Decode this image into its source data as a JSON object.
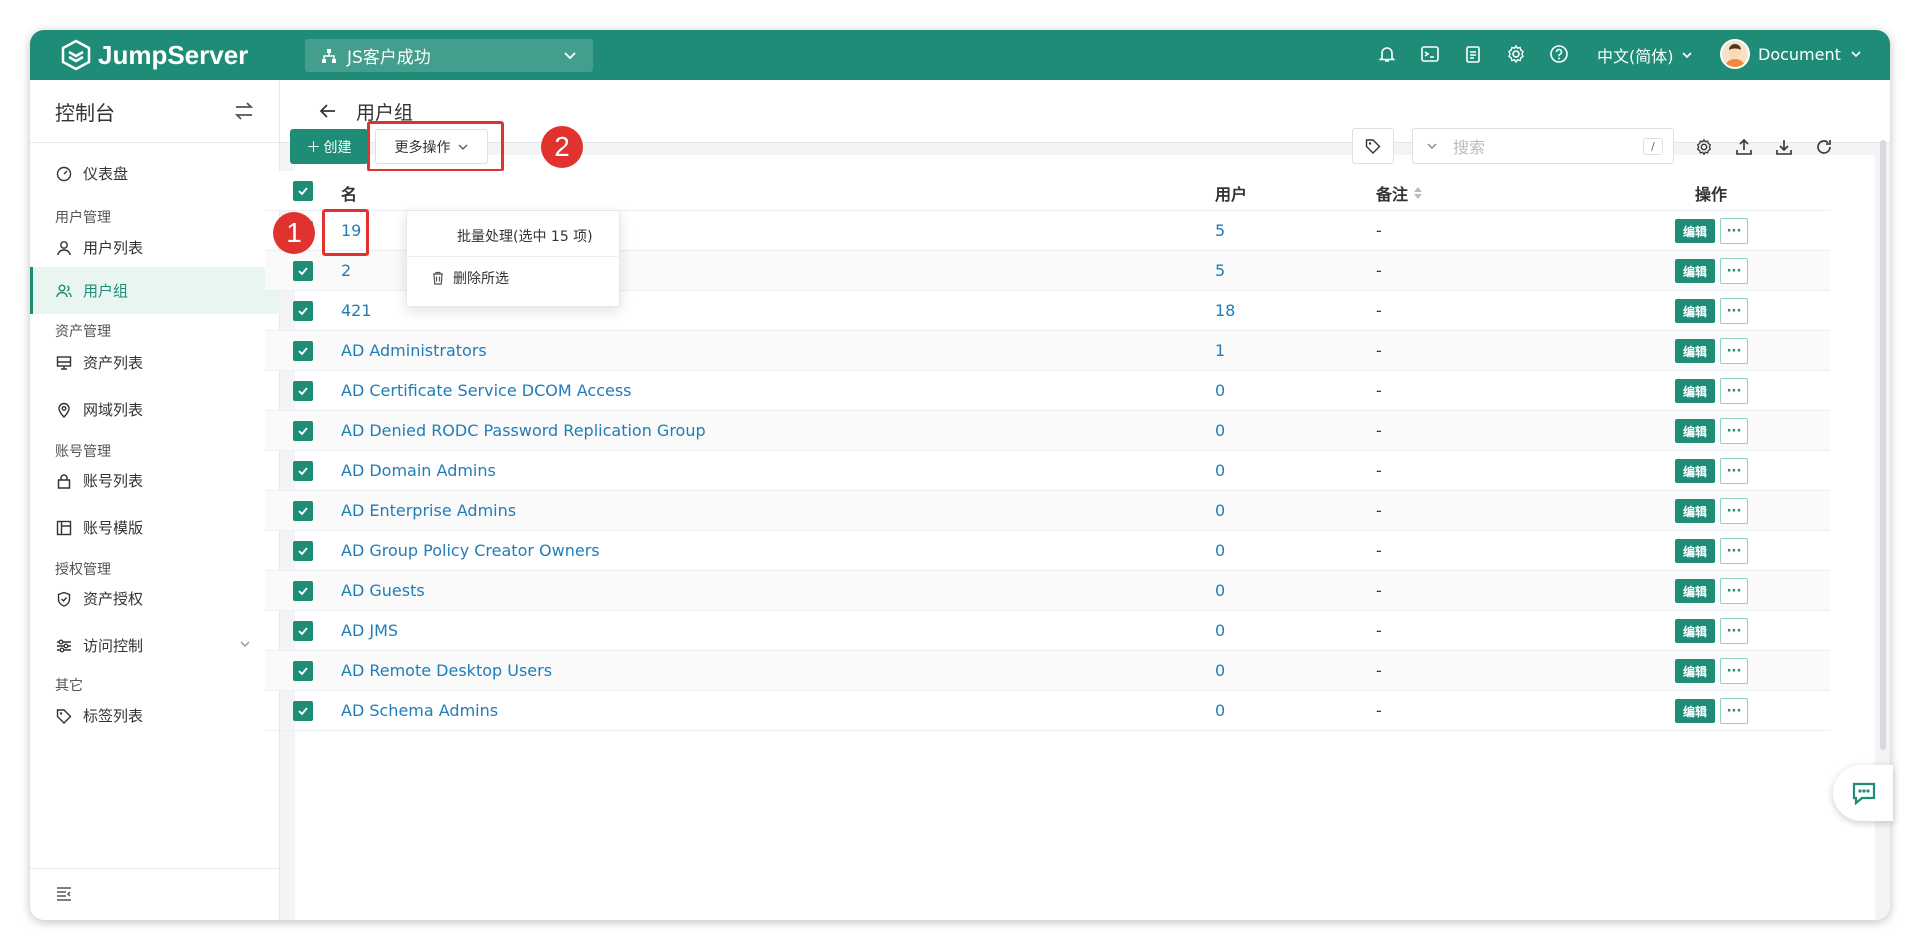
{
  "topbar": {
    "brand": "JumpServer",
    "org": "JS客户成功",
    "language": "中文(简体)",
    "user": "Document",
    "icons": [
      "bell-icon",
      "terminal-icon",
      "clipboard-icon",
      "gear-icon",
      "help-icon"
    ]
  },
  "sidebar": {
    "title": "控制台",
    "groups": {
      "user_mgmt": "用户管理",
      "asset_mgmt": "资产管理",
      "account_mgmt": "账号管理",
      "perm_mgmt": "授权管理",
      "other": "其它"
    },
    "items": {
      "dashboard": "仪表盘",
      "user_list": "用户列表",
      "user_group": "用户组",
      "asset_list": "资产列表",
      "domain_list": "网域列表",
      "account_list": "账号列表",
      "account_template": "账号模版",
      "asset_perm": "资产授权",
      "access_control": "访问控制",
      "tag_list": "标签列表"
    }
  },
  "page": {
    "title": "用户组"
  },
  "toolbar": {
    "create_label": "创建",
    "more_label": "更多操作",
    "search_placeholder": "搜索",
    "search_shortcut": "/"
  },
  "dropdown": {
    "batch_label": "批量处理(选中 15 项)",
    "delete_label": "删除所选"
  },
  "annotations": {
    "one": "1",
    "two": "2"
  },
  "table": {
    "headers": {
      "name": "名",
      "users": "用户",
      "note": "备注",
      "ops": "操作"
    },
    "edit_label": "编辑",
    "more_label": "···",
    "rows": [
      {
        "name": "19",
        "users": "5",
        "note": "-"
      },
      {
        "name": "2",
        "users": "5",
        "note": "-"
      },
      {
        "name": "421",
        "users": "18",
        "note": "-"
      },
      {
        "name": "AD Administrators",
        "users": "1",
        "note": "-"
      },
      {
        "name": "AD Certificate Service DCOM Access",
        "users": "0",
        "note": "-"
      },
      {
        "name": "AD Denied RODC Password Replication Group",
        "users": "0",
        "note": "-"
      },
      {
        "name": "AD Domain Admins",
        "users": "0",
        "note": "-"
      },
      {
        "name": "AD Enterprise Admins",
        "users": "0",
        "note": "-"
      },
      {
        "name": "AD Group Policy Creator Owners",
        "users": "0",
        "note": "-"
      },
      {
        "name": "AD Guests",
        "users": "0",
        "note": "-"
      },
      {
        "name": "AD JMS",
        "users": "0",
        "note": "-"
      },
      {
        "name": "AD Remote Desktop Users",
        "users": "0",
        "note": "-"
      },
      {
        "name": "AD Schema Admins",
        "users": "0",
        "note": "-"
      }
    ]
  },
  "colors": {
    "brand": "#1f8c78",
    "link": "#1f7db8",
    "highlight": "#e0322f"
  }
}
